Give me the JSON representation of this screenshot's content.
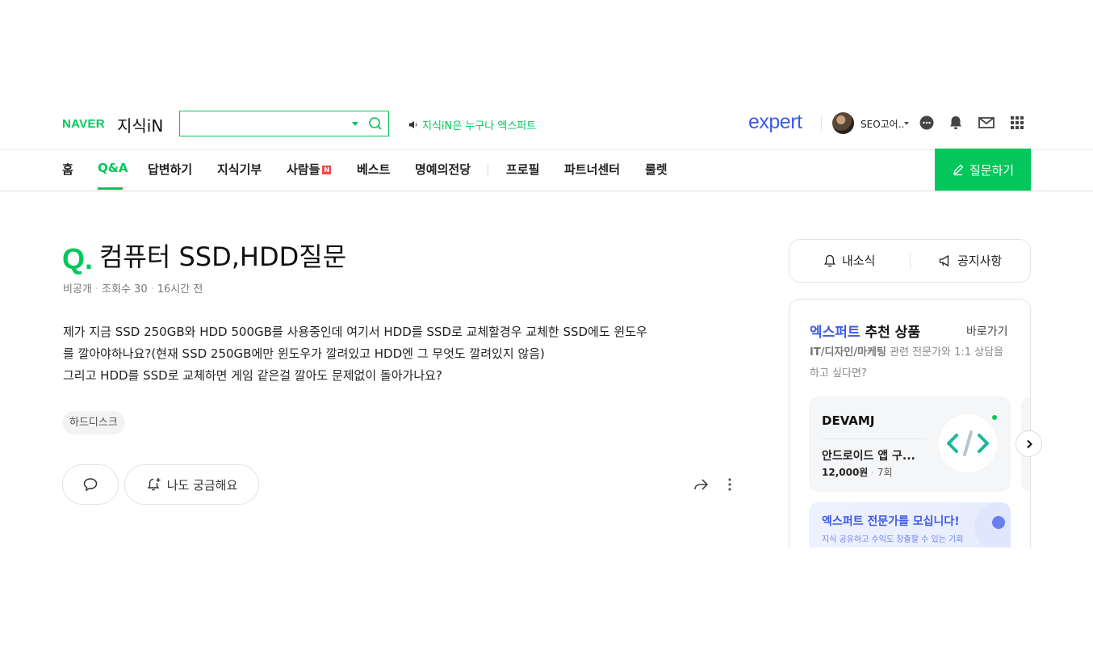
{
  "header": {
    "logo_naver": "NAVER",
    "logo_service": "지식iN",
    "search": {
      "placeholder": "",
      "value": ""
    },
    "notice": "지식iN은 누구나 엑스퍼트",
    "expert_logo": "expert",
    "user_name": "SEO고어..",
    "icons": [
      "talk-icon",
      "bell-icon",
      "mail-icon",
      "apps-grid-icon"
    ],
    "brand_color": "#03c75a",
    "expert_color": "#3d5ce8"
  },
  "nav": {
    "items": [
      "홈",
      "Q&A",
      "답변하기",
      "지식기부",
      "사람들",
      "베스트",
      "명예의전당",
      "프로필",
      "파트너센터",
      "룰렛"
    ],
    "active": "Q&A",
    "new_badge": "N",
    "ask_button": "질문하기"
  },
  "question": {
    "q_mark": "Q.",
    "title": "컴퓨터 SSD,HDD질문",
    "meta": {
      "author": "비공개",
      "views": "조회수 30",
      "time": "16시간 전"
    },
    "body": [
      "제가 지금 SSD 250GB와 HDD 500GB를 사용중인데 여기서 HDD를 SSD로 교체할경우 교체한 SSD에도 윈도우",
      "를 깔아야하나요?(현재 SSD 250GB에만 윈도우가 깔려있고 HDD엔 그 무엇도 깔려있지 않음)",
      "그리고 HDD를 SSD로 교체하면 게임 같은걸 깔아도 문제없이 돌아가나요?"
    ],
    "tag": "하드디스크",
    "curious_label": "나도 궁금해요"
  },
  "sidebar": {
    "news_label": "내소식",
    "notice_label": "공지사항",
    "expert": {
      "title_blue": "엑스퍼트",
      "title_rest": " 추천 상품",
      "link": "바로가기",
      "desc_bold": "IT/디자인/마케팅",
      "desc_rest": " 관련 전문가와 1:1 상담을 하고 싶다면?",
      "product": {
        "name": "DEVAMJ",
        "title": "안드로이드 앱 구...",
        "price": "12,000원",
        "count": "7회"
      },
      "banner_title": "엑스퍼트 전문가를 모십니다!",
      "banner_sub": "지식 공유하고 수익도 창출할 수 있는 기회"
    }
  }
}
